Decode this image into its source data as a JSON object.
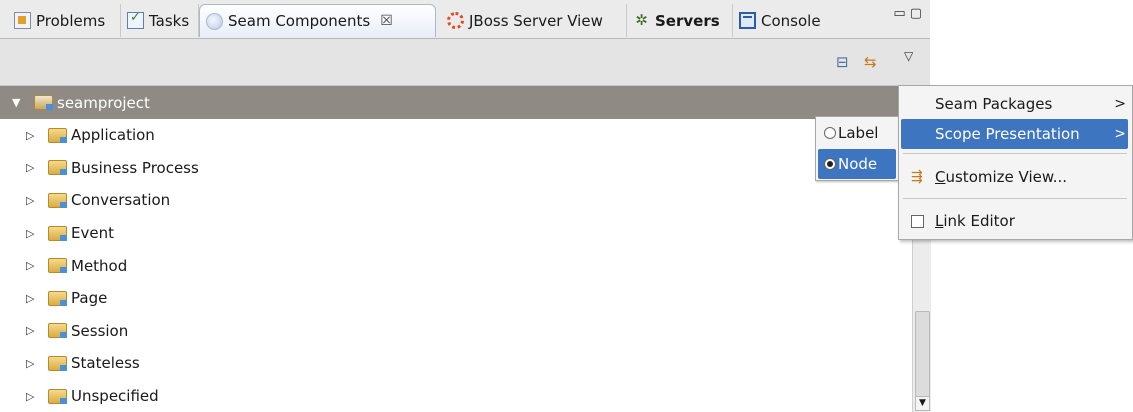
{
  "tabs": [
    {
      "label": "Problems",
      "icon": "problems-icon"
    },
    {
      "label": "Tasks",
      "icon": "tasks-icon"
    },
    {
      "label": "Seam Components",
      "icon": "seam-icon",
      "active": true,
      "close": "☒"
    },
    {
      "label": "JBoss Server View",
      "icon": "jboss-icon"
    },
    {
      "label": "Servers",
      "icon": "servers-icon"
    },
    {
      "label": "Console",
      "icon": "console-icon"
    }
  ],
  "tree": {
    "root": "seamproject",
    "items": [
      "Application",
      "Business Process",
      "Conversation",
      "Event",
      "Method",
      "Page",
      "Session",
      "Stateless",
      "Unspecified"
    ]
  },
  "menu": {
    "items": [
      {
        "label": "Seam Packages",
        "arrow": ">"
      },
      {
        "label": "Scope Presentation",
        "arrow": ">"
      },
      {
        "label_pre": "",
        "label_u": "C",
        "label_post": "ustomize View..."
      },
      {
        "label_pre": "",
        "label_u": "L",
        "label_post": "ink Editor"
      }
    ],
    "submenu": [
      {
        "label": "Label",
        "selected": false
      },
      {
        "label": "Node",
        "selected": true
      }
    ]
  },
  "colors": {
    "selection": "#3d75c0",
    "root_row": "#8f8a84"
  }
}
